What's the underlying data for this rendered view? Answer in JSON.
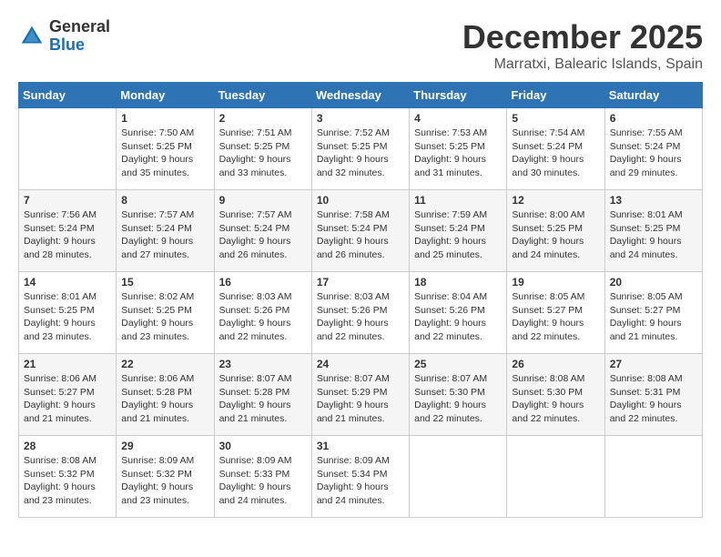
{
  "logo": {
    "line1": "General",
    "line2": "Blue"
  },
  "title": "December 2025",
  "location": "Marratxi, Balearic Islands, Spain",
  "days_of_week": [
    "Sunday",
    "Monday",
    "Tuesday",
    "Wednesday",
    "Thursday",
    "Friday",
    "Saturday"
  ],
  "weeks": [
    [
      null,
      {
        "num": "1",
        "sunrise": "7:50 AM",
        "sunset": "5:25 PM",
        "daylight": "9 hours and 35 minutes."
      },
      {
        "num": "2",
        "sunrise": "7:51 AM",
        "sunset": "5:25 PM",
        "daylight": "9 hours and 33 minutes."
      },
      {
        "num": "3",
        "sunrise": "7:52 AM",
        "sunset": "5:25 PM",
        "daylight": "9 hours and 32 minutes."
      },
      {
        "num": "4",
        "sunrise": "7:53 AM",
        "sunset": "5:25 PM",
        "daylight": "9 hours and 31 minutes."
      },
      {
        "num": "5",
        "sunrise": "7:54 AM",
        "sunset": "5:24 PM",
        "daylight": "9 hours and 30 minutes."
      },
      {
        "num": "6",
        "sunrise": "7:55 AM",
        "sunset": "5:24 PM",
        "daylight": "9 hours and 29 minutes."
      }
    ],
    [
      {
        "num": "7",
        "sunrise": "7:56 AM",
        "sunset": "5:24 PM",
        "daylight": "9 hours and 28 minutes."
      },
      {
        "num": "8",
        "sunrise": "7:57 AM",
        "sunset": "5:24 PM",
        "daylight": "9 hours and 27 minutes."
      },
      {
        "num": "9",
        "sunrise": "7:57 AM",
        "sunset": "5:24 PM",
        "daylight": "9 hours and 26 minutes."
      },
      {
        "num": "10",
        "sunrise": "7:58 AM",
        "sunset": "5:24 PM",
        "daylight": "9 hours and 26 minutes."
      },
      {
        "num": "11",
        "sunrise": "7:59 AM",
        "sunset": "5:24 PM",
        "daylight": "9 hours and 25 minutes."
      },
      {
        "num": "12",
        "sunrise": "8:00 AM",
        "sunset": "5:25 PM",
        "daylight": "9 hours and 24 minutes."
      },
      {
        "num": "13",
        "sunrise": "8:01 AM",
        "sunset": "5:25 PM",
        "daylight": "9 hours and 24 minutes."
      }
    ],
    [
      {
        "num": "14",
        "sunrise": "8:01 AM",
        "sunset": "5:25 PM",
        "daylight": "9 hours and 23 minutes."
      },
      {
        "num": "15",
        "sunrise": "8:02 AM",
        "sunset": "5:25 PM",
        "daylight": "9 hours and 23 minutes."
      },
      {
        "num": "16",
        "sunrise": "8:03 AM",
        "sunset": "5:26 PM",
        "daylight": "9 hours and 22 minutes."
      },
      {
        "num": "17",
        "sunrise": "8:03 AM",
        "sunset": "5:26 PM",
        "daylight": "9 hours and 22 minutes."
      },
      {
        "num": "18",
        "sunrise": "8:04 AM",
        "sunset": "5:26 PM",
        "daylight": "9 hours and 22 minutes."
      },
      {
        "num": "19",
        "sunrise": "8:05 AM",
        "sunset": "5:27 PM",
        "daylight": "9 hours and 22 minutes."
      },
      {
        "num": "20",
        "sunrise": "8:05 AM",
        "sunset": "5:27 PM",
        "daylight": "9 hours and 21 minutes."
      }
    ],
    [
      {
        "num": "21",
        "sunrise": "8:06 AM",
        "sunset": "5:27 PM",
        "daylight": "9 hours and 21 minutes."
      },
      {
        "num": "22",
        "sunrise": "8:06 AM",
        "sunset": "5:28 PM",
        "daylight": "9 hours and 21 minutes."
      },
      {
        "num": "23",
        "sunrise": "8:07 AM",
        "sunset": "5:28 PM",
        "daylight": "9 hours and 21 minutes."
      },
      {
        "num": "24",
        "sunrise": "8:07 AM",
        "sunset": "5:29 PM",
        "daylight": "9 hours and 21 minutes."
      },
      {
        "num": "25",
        "sunrise": "8:07 AM",
        "sunset": "5:30 PM",
        "daylight": "9 hours and 22 minutes."
      },
      {
        "num": "26",
        "sunrise": "8:08 AM",
        "sunset": "5:30 PM",
        "daylight": "9 hours and 22 minutes."
      },
      {
        "num": "27",
        "sunrise": "8:08 AM",
        "sunset": "5:31 PM",
        "daylight": "9 hours and 22 minutes."
      }
    ],
    [
      {
        "num": "28",
        "sunrise": "8:08 AM",
        "sunset": "5:32 PM",
        "daylight": "9 hours and 23 minutes."
      },
      {
        "num": "29",
        "sunrise": "8:09 AM",
        "sunset": "5:32 PM",
        "daylight": "9 hours and 23 minutes."
      },
      {
        "num": "30",
        "sunrise": "8:09 AM",
        "sunset": "5:33 PM",
        "daylight": "9 hours and 24 minutes."
      },
      {
        "num": "31",
        "sunrise": "8:09 AM",
        "sunset": "5:34 PM",
        "daylight": "9 hours and 24 minutes."
      },
      null,
      null,
      null
    ]
  ]
}
